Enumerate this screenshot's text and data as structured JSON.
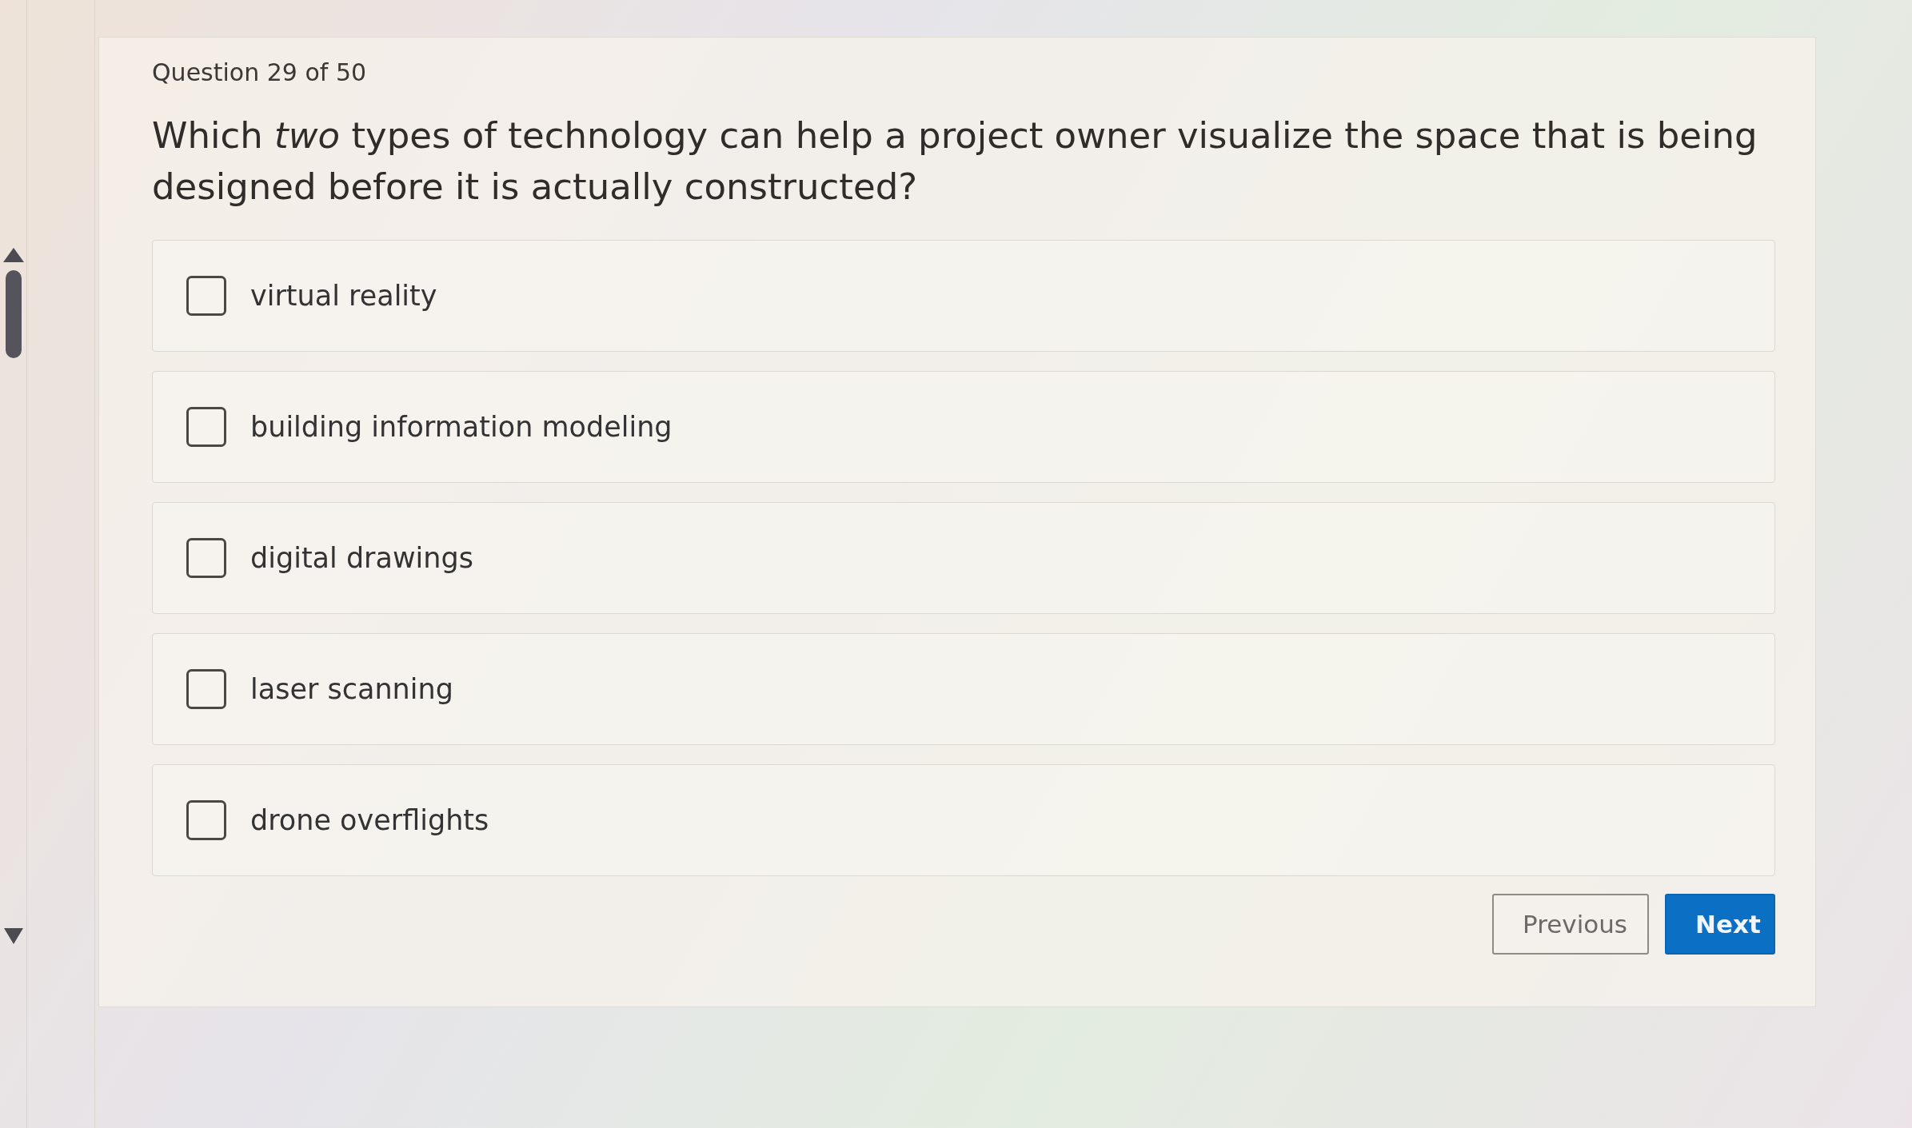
{
  "header": {
    "progress": "Question 29 of 50"
  },
  "question": {
    "text": "Which *two* types of technology can help a project owner visualize the space that is being designed before it is actually constructed?"
  },
  "options": [
    {
      "label": "virtual reality",
      "checked": false
    },
    {
      "label": "building information modeling",
      "checked": false
    },
    {
      "label": "digital drawings",
      "checked": false
    },
    {
      "label": "laser scanning",
      "checked": false
    },
    {
      "label": "drone overflights",
      "checked": false
    }
  ],
  "buttons": [
    {
      "kind": "secondary",
      "label": "Previous"
    },
    {
      "kind": "primary",
      "label": "Next"
    }
  ]
}
